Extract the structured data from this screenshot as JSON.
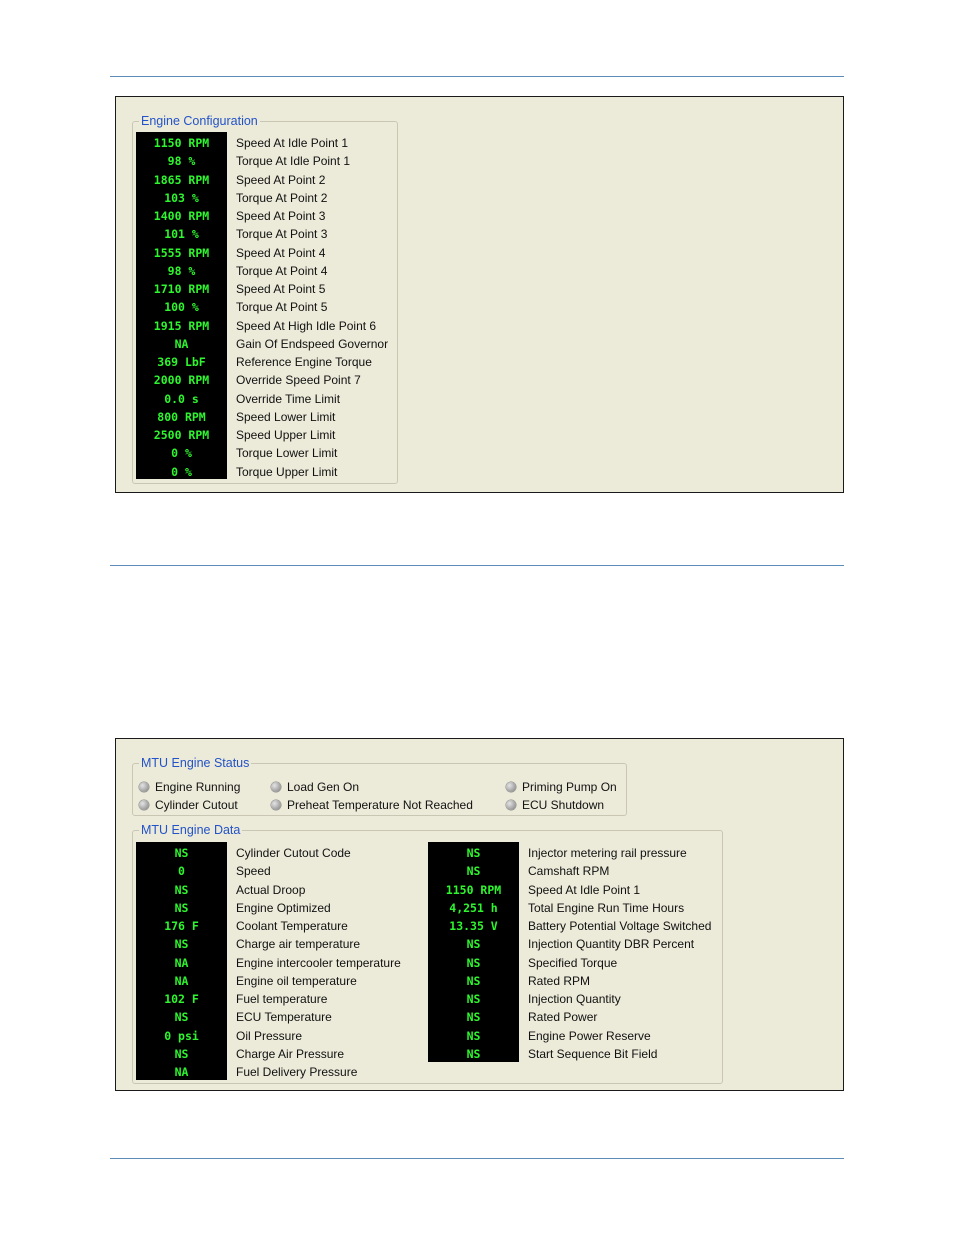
{
  "engine_configuration": {
    "title": "Engine Configuration",
    "rows": [
      {
        "value": "1150 RPM",
        "label": "Speed At Idle Point 1"
      },
      {
        "value": "98 %",
        "label": "Torque At Idle Point 1"
      },
      {
        "value": "1865 RPM",
        "label": "Speed At Point 2"
      },
      {
        "value": "103 %",
        "label": "Torque At Point 2"
      },
      {
        "value": "1400 RPM",
        "label": "Speed At Point 3"
      },
      {
        "value": "101 %",
        "label": "Torque At Point 3"
      },
      {
        "value": "1555 RPM",
        "label": "Speed At Point 4"
      },
      {
        "value": "98 %",
        "label": "Torque At Point 4"
      },
      {
        "value": "1710 RPM",
        "label": "Speed At Point 5"
      },
      {
        "value": "100 %",
        "label": "Torque At Point 5"
      },
      {
        "value": "1915 RPM",
        "label": "Speed At High Idle Point 6"
      },
      {
        "value": "NA",
        "label": "Gain Of Endspeed Governor"
      },
      {
        "value": "369 LbF",
        "label": "Reference Engine Torque"
      },
      {
        "value": "2000 RPM",
        "label": "Override Speed Point 7"
      },
      {
        "value": "0.0 s",
        "label": "Override Time Limit"
      },
      {
        "value": "800 RPM",
        "label": "Speed Lower Limit"
      },
      {
        "value": "2500 RPM",
        "label": "Speed Upper Limit"
      },
      {
        "value": "0 %",
        "label": "Torque Lower Limit"
      },
      {
        "value": "0 %",
        "label": "Torque Upper Limit"
      }
    ]
  },
  "mtu_engine_status": {
    "title": "MTU Engine Status",
    "indicators": [
      {
        "label": "Engine Running"
      },
      {
        "label": "Load Gen On"
      },
      {
        "label": "Priming Pump On"
      },
      {
        "label": "Cylinder Cutout"
      },
      {
        "label": "Preheat Temperature Not Reached"
      },
      {
        "label": "ECU Shutdown"
      }
    ]
  },
  "mtu_engine_data": {
    "title": "MTU Engine Data",
    "left": [
      {
        "value": "NS",
        "label": "Cylinder Cutout Code"
      },
      {
        "value": "0",
        "label": "Speed"
      },
      {
        "value": "NS",
        "label": "Actual Droop"
      },
      {
        "value": "NS",
        "label": "Engine Optimized"
      },
      {
        "value": "176 F",
        "label": "Coolant Temperature"
      },
      {
        "value": "NS",
        "label": "Charge air temperature"
      },
      {
        "value": "NA",
        "label": "Engine intercooler temperature"
      },
      {
        "value": "NA",
        "label": "Engine oil temperature"
      },
      {
        "value": "102 F",
        "label": "Fuel temperature"
      },
      {
        "value": "NS",
        "label": "ECU Temperature"
      },
      {
        "value": "0 psi",
        "label": "Oil Pressure"
      },
      {
        "value": "NS",
        "label": "Charge Air Pressure"
      },
      {
        "value": "NA",
        "label": "Fuel Delivery Pressure"
      }
    ],
    "right": [
      {
        "value": "NS",
        "label": "Injector metering rail pressure"
      },
      {
        "value": "NS",
        "label": "Camshaft RPM"
      },
      {
        "value": "1150 RPM",
        "label": "Speed At Idle Point 1"
      },
      {
        "value": "4,251 h",
        "label": "Total Engine Run Time Hours"
      },
      {
        "value": "13.35 V",
        "label": "Battery Potential Voltage Switched"
      },
      {
        "value": "NS",
        "label": "Injection Quantity DBR Percent"
      },
      {
        "value": "NS",
        "label": "Specified Torque"
      },
      {
        "value": "NS",
        "label": "Rated RPM"
      },
      {
        "value": "NS",
        "label": "Injection Quantity"
      },
      {
        "value": "NS",
        "label": "Rated Power"
      },
      {
        "value": "NS",
        "label": "Engine Power Reserve"
      },
      {
        "value": "NS",
        "label": "Start Sequence Bit Field"
      }
    ]
  }
}
